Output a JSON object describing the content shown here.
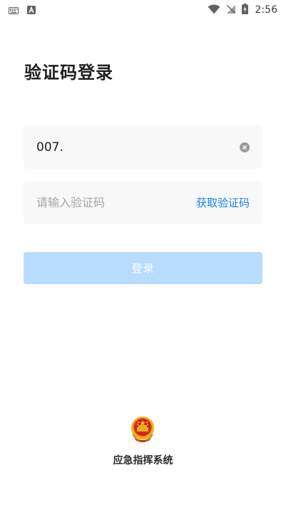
{
  "status_bar": {
    "time": "2:56",
    "icons": [
      "keyboard-icon",
      "text-a-icon",
      "wifi-icon",
      "no-signal-icon",
      "battery-charging-icon"
    ]
  },
  "login": {
    "title": "验证码登录",
    "phone_value": "007.",
    "code_placeholder": "请输入验证码",
    "get_code_label": "获取验证码",
    "login_button_label": "登录"
  },
  "footer": {
    "system_name": "应急指挥系统"
  },
  "colors": {
    "accent": "#1a82e2",
    "button_disabled": "#b8dcfd",
    "field_bg": "#f8f8f8"
  }
}
